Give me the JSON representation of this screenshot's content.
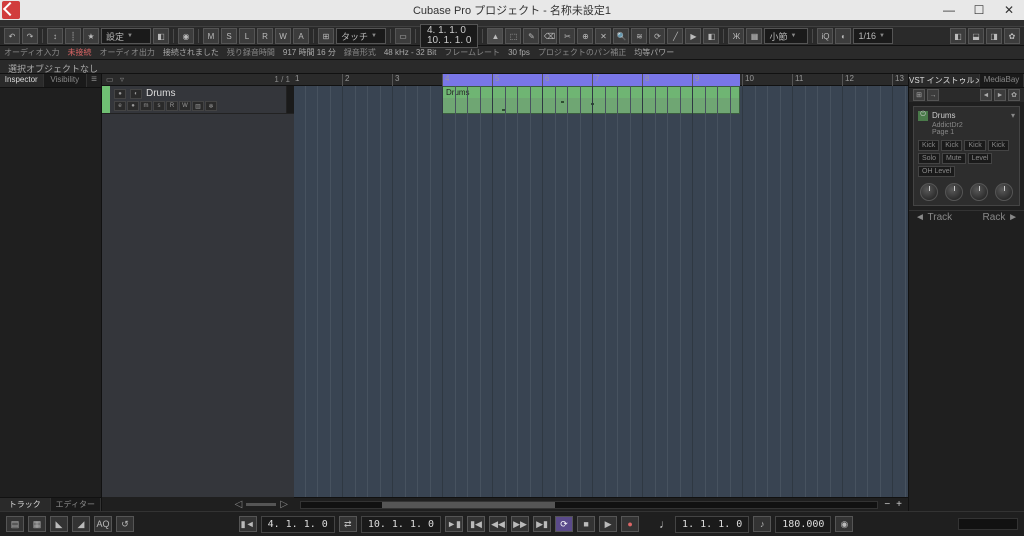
{
  "window": {
    "title": "Cubase Pro プロジェクト - 名称未設定1"
  },
  "toolbar": {
    "config_label": "設定",
    "automation": {
      "m": "M",
      "s": "S",
      "l": "L",
      "r": "R",
      "w": "W",
      "a": "A"
    },
    "touch_label": "タッチ",
    "time1": "4. 1. 1. 0",
    "time2": "10. 1. 1. 0",
    "grid_label": "小節",
    "quantize": "1/16"
  },
  "status": {
    "audio_in": "オーディオ入力",
    "not_connected": "未接続",
    "audio_out": "オーディオ出力",
    "connected": "接続されました",
    "rec_time_lbl": "残り録音時間",
    "rec_time": "917 時間 16 分",
    "format_lbl": "録音形式",
    "format": "48 kHz - 32 Bit",
    "framerate_lbl": "フレームレート",
    "framerate": "30 fps",
    "pan_lbl": "プロジェクトのパン補正",
    "pan": "均等パワー"
  },
  "infobar": {
    "no_selection": "選択オブジェクトなし"
  },
  "left_tabs": {
    "inspector": "Inspector",
    "visibility": "Visibility"
  },
  "left_bottom": {
    "track": "トラック",
    "editor": "エディター"
  },
  "tracklist": {
    "hdr_count": "1 / 1"
  },
  "track": {
    "name": "Drums",
    "ctrls": {
      "e": "e",
      "dot": "●",
      "m": "m",
      "s": "s",
      "r": "R",
      "w": "W",
      "rec": "●",
      "mon": "◐",
      "frz": "❄"
    }
  },
  "ruler": {
    "bars": [
      1,
      2,
      3,
      4,
      5,
      6,
      7,
      8,
      9,
      10,
      11,
      12,
      13
    ]
  },
  "event": {
    "name": "Drums"
  },
  "right_tabs": {
    "vsti": "VST インストゥルメント",
    "mediabay": "MediaBay"
  },
  "instrument": {
    "name": "Drums",
    "plugin": "AddictDr2",
    "page": "Page 1",
    "params": [
      "Kick",
      "Kick",
      "Kick",
      "Kick",
      "Solo",
      "Mute",
      "Level",
      "OH Level"
    ]
  },
  "right_foot": {
    "track": "◄ Track",
    "rack": "Rack ►"
  },
  "transport": {
    "aq": "AQ",
    "markerL": "▮◄",
    "markerR": "►▮",
    "primary": "4. 1. 1. 0",
    "secondary": "10. 1. 1. 0",
    "sig": "1. 1. 1. 0",
    "tempo": "180.000",
    "note": "♩"
  }
}
